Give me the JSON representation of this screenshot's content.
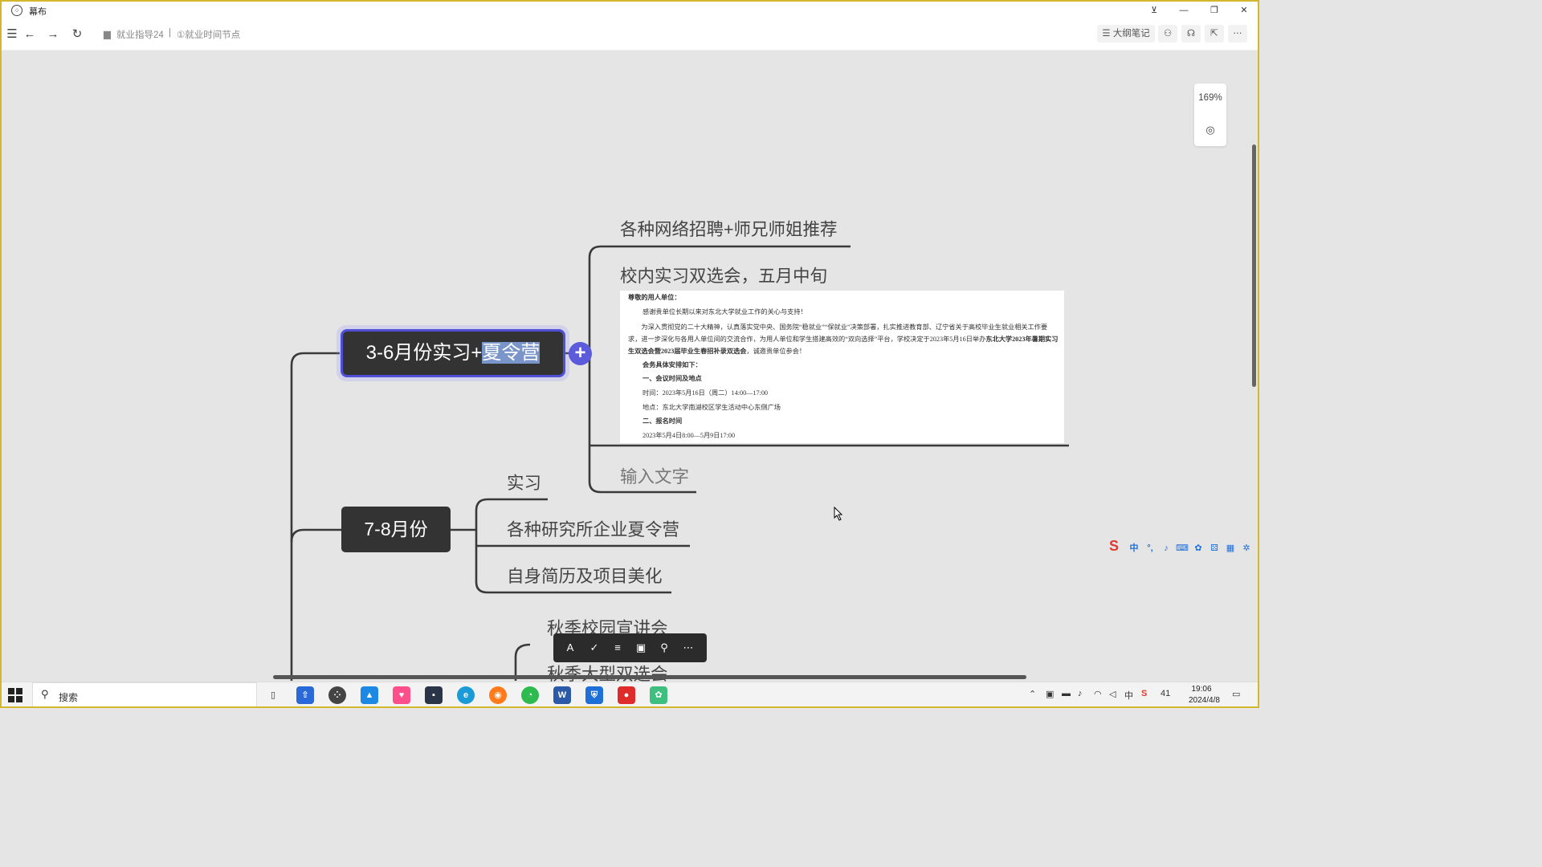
{
  "app": {
    "title": "幕布"
  },
  "window_controls": {
    "pin": "⊻",
    "minimize": "—",
    "restore": "❐",
    "close": "✕"
  },
  "toolbar": {
    "breadcrumb_folder": "就业指导24",
    "breadcrumb_sep": "|",
    "breadcrumb_doc": "①就业时间节点",
    "outline_notes_label": "大纲笔记"
  },
  "zoom": {
    "level": "169%"
  },
  "mindmap": {
    "root_prefix": "3-6月份实习+",
    "root_highlighted": "夏令营",
    "plus": "+",
    "branch1_children": [
      "各种网络招聘+师兄师姐推荐",
      "校内实习双选会，五月中旬",
      "输入文字"
    ],
    "node2": "7-8月份",
    "branch2_children": [
      "实习",
      "各种研究所企业夏令营",
      "自身简历及项目美化"
    ],
    "branch3_children": [
      "秋季校园宣讲会",
      "秋季大型双选会"
    ]
  },
  "notice": {
    "salutation": "尊敬的用人单位：",
    "thanks": "感谢贵单位长期以来对东北大学就业工作的关心与支持！",
    "body_a": "为深入贯彻党的二十大精神，认真落实党中央、国务院“稳就业”“保就业”决策部署，扎实推进教育部、辽宁省关于高校毕业生就业相关工作要求，进一步深化与各用人单位间的交流合作，为用人单位和学生搭建高效的“双向选择”平台，学校决定于2023年5月16日举办",
    "body_bold": "东北大学2023年暑期实习生双选会暨2023届毕业生春招补录双选会",
    "body_b": "，诚邀贵单位参会！",
    "arrange_title": "会务具体安排如下：",
    "section1": "一、会议时间及地点",
    "time": "时间：2023年5月16日（周二）14:00—17:00",
    "place": "地点：东北大学南湖校区学生活动中心东侧广场",
    "section2": "二、报名时间",
    "reg_time": "2023年5月4日8:00—5月9日17:00"
  },
  "format_toolbar": {
    "icons": [
      "text-style-icon",
      "check-circle-icon",
      "note-icon",
      "image-icon",
      "link-icon",
      "more-icon"
    ]
  },
  "ime": {
    "mode": "中",
    "punct": "°,"
  },
  "taskbar": {
    "search_placeholder": "搜索",
    "apps": [
      "task-view",
      "app-blue",
      "mubu",
      "app-photos",
      "app-pink",
      "app-dark",
      "edge",
      "firefox",
      "wechat",
      "word",
      "app-shield",
      "app-red",
      "app-green"
    ],
    "tray_ime": "中",
    "tray_temp": "41",
    "time": "19:06",
    "date": "2024/4/8"
  },
  "colors": {
    "node_bg": "#333333",
    "accent": "#5b5bdc",
    "highlight": "#7a95c9",
    "canvas": "#e5e5e5"
  }
}
